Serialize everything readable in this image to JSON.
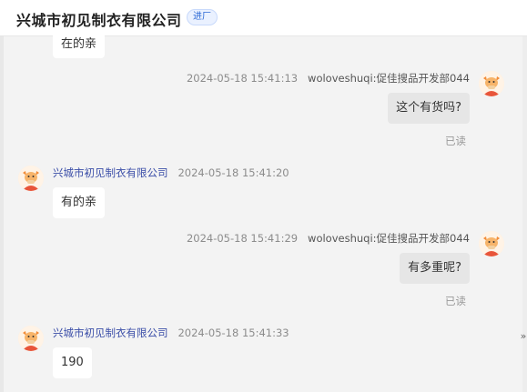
{
  "header": {
    "title": "兴城市初见制衣有限公司",
    "tag": "进厂"
  },
  "messages": [
    {
      "side": "left",
      "text": "在的亲"
    },
    {
      "side": "right",
      "timestamp": "2024-05-18 15:41:13",
      "sender": "woloveshuqi:促佳搜品开发部044",
      "text": "这个有货吗?",
      "status": "已读"
    },
    {
      "side": "left",
      "sender": "兴城市初见制衣有限公司",
      "timestamp": "2024-05-18 15:41:20",
      "text": "有的亲"
    },
    {
      "side": "right",
      "timestamp": "2024-05-18 15:41:29",
      "sender": "woloveshuqi:促佳搜品开发部044",
      "text": "有多重呢?",
      "status": "已读"
    },
    {
      "side": "left",
      "sender": "兴城市初见制衣有限公司",
      "timestamp": "2024-05-18 15:41:33",
      "text": "190"
    }
  ],
  "scroll_arrow": "»",
  "icons": {
    "avatar": "cartoon-bull-avatar-icon"
  },
  "colors": {
    "tag_text": "#2f6bd6",
    "left_sender": "#3b4ea8",
    "mine_bubble": "#e6e6e6"
  }
}
